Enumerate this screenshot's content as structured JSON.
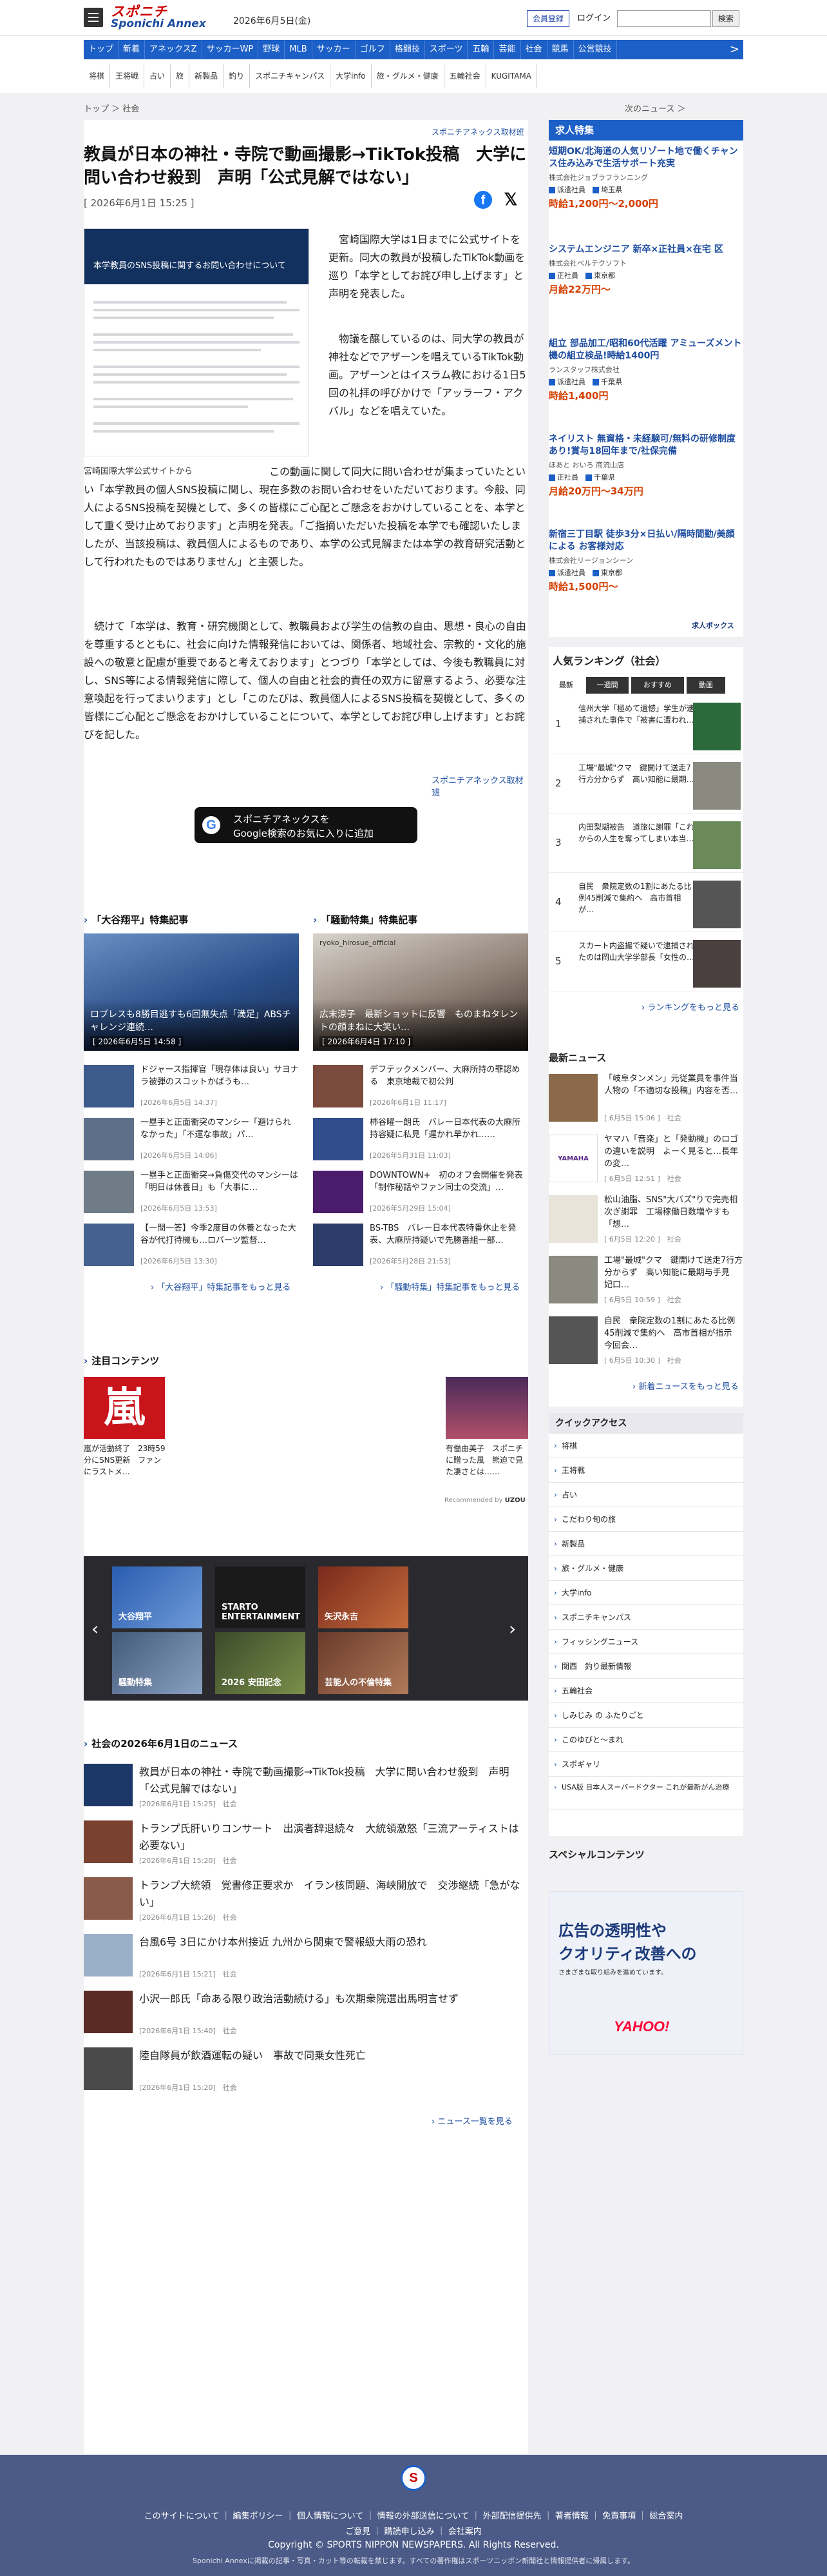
{
  "header": {
    "logo_line1": "スポニチ",
    "logo_line2": "Sponichi Annex",
    "date": "2026年6月5日(金)",
    "member_label": "会員登録",
    "login_label": "ログイン",
    "search_placeholder": "",
    "search_button": "検索"
  },
  "nav": [
    "トップ",
    "新着",
    "アネックスZ",
    "サッカーWP",
    "野球",
    "MLB",
    "サッカー",
    "ゴルフ",
    "格闘技",
    "スポーツ",
    "五輪",
    "芸能",
    "社会",
    "競馬",
    "公営競技"
  ],
  "subnav": [
    "将棋",
    "王将戦",
    "占い",
    "旅",
    "新製品",
    "釣り",
    "スポニチキャンパス",
    "大学info",
    "旅・グルメ・健康",
    "五輪社会",
    "KUGITAMA"
  ],
  "breadcrumb": "トップ ＞ 社会",
  "next_label": "次のニュース ＞",
  "article": {
    "source": "スポニチアネックス取材班",
    "title": "教員が日本の神社・寺院で動画撮影→TikTok投稿　大学に問い合わせ殺到　声明「公式見解ではない」",
    "date": "[ 2026年6月1日 15:25 ]",
    "photo_heading": "本学教員のSNS投稿に関するお問い合わせについて",
    "photo_caption": "宮崎国際大学公式サイトから",
    "p1": "宮崎国際大学は1日までに公式サイトを更新。同大の教員が投稿したTikTok動画を巡り「本学としてお詫び申し上げます」と声明を発表した。",
    "p2": "物議を醸しているのは、同大学の教員が神社などでアザーンを唱えているTikTok動画。アザーンとはイスラム教における1日5回の礼拝の呼びかけで「アッラーフ・アクバル」などを唱えていた。",
    "p3": "この動画に関して同大に問い合わせが集まっていたといい「本学教員の個人SNS投稿に関し、現在多数のお問い合わせをいただいております。今般、同人によるSNS投稿を契機として、多くの皆様にご心配とご懸念をおかけしていることを、本学として重く受け止めております」と声明を発表。「ご指摘いただいた投稿を本学でも確認いたしましたが、当該投稿は、教員個人によるものであり、本学の公式見解または本学の教育研究活動として行われたものではありません」と主張した。",
    "p4": "続けて「本学は、教育・研究機関として、教職員および学生の信教の自由、思想・良心の自由を尊重するとともに、社会に向けた情報発信においては、関係者、地域社会、宗教的・文化的施設への敬意と配慮が重要であると考えております」とつづり「本学としては、今後も教職員に対し、SNS等による情報発信に際して、個人の自由と社会的責任の双方に留意するよう、必要な注意喚起を行ってまいります」とし「このたびは、教員個人によるSNS投稿を契機として、多くの皆様にご心配とご懸念をおかけしていることについて、本学としてお詫び申し上げます」とお詫びを記した。",
    "source_bottom": "スポニチアネックス取材班",
    "google_line1": "スポニチアネックスを",
    "google_line2": "Google検索のお気に入りに追加"
  },
  "features": {
    "left": {
      "title": "「大谷翔平」特集記事",
      "hero_title": "ロブレスも8勝目逃すも6回無失点「満足」ABSチャレンジ連続…",
      "hero_date": "[ 2026年6月5日 14:58 ]",
      "items": [
        {
          "title": "ドジャース指揮官「現存体は良い」サヨナラ被弾のスコットかばうも…",
          "date": "[2026年6月5日 14:37]"
        },
        {
          "title": "一塁手と正面衝突のマンシー「避けられなかった」「不運な事故」パ…",
          "date": "[2026年6月5日 14:06]"
        },
        {
          "title": "一塁手と正面衝突→負傷交代のマンシーは「明日は休養日」も「大事に…",
          "date": "[2026年6月5日 13:53]"
        },
        {
          "title": "【一問一答】今季2度目の休養となった大谷が代打待機も…ロバーツ監督…",
          "date": "[2026年6月5日 13:30]"
        }
      ],
      "more": "「大谷翔平」特集記事をもっと見る"
    },
    "right": {
      "title": "「騒動特集」特集記事",
      "hero_title": "広末涼子　最新ショットに反響　ものまねタレントの顔まねに大笑い…",
      "hero_date": "[ 2026年6月4日 17:10 ]",
      "hero_account": "ryoko_hirosue_official",
      "items": [
        {
          "title": "デフテックメンバー、大麻所持の罪認める　東京地裁で初公判",
          "date": "[2026年6月1日 11:17]"
        },
        {
          "title": "柿谷曜一朗氏　バレー日本代表の大麻所持容疑に私見「遅かれ早かれ……",
          "date": "[2026年5月31日 11:03]"
        },
        {
          "title": "DOWNTOWN+　初のオフ会開催を発表「制作秘話やファン同士の交流」…",
          "date": "[2026年5月29日 15:04]"
        },
        {
          "title": "BS-TBS　バレー日本代表特番休止を発表、大麻所持疑いで先勝番組一部…",
          "date": "[2026年5月28日 21:53]"
        }
      ],
      "more": "「騒動特集」特集記事をもっと見る"
    }
  },
  "attention": {
    "title": "注目コンテンツ",
    "left_title": "嵐が活動終了　23時59分にSNS更新　ファンにラストメ…",
    "right_title": "有働由美子　スポニチに贈った風　熊迫で見た凄さとは……",
    "recommend": "Recommended by",
    "uzou": "UZOU"
  },
  "slider": [
    {
      "label": "大谷翔平"
    },
    {
      "label": "STARTO ENTERTAINMENT"
    },
    {
      "label": "矢沢永吉"
    },
    {
      "label": "騒動特集"
    },
    {
      "label": "2026 安田記念"
    },
    {
      "label": "芸能人の不倫特集"
    }
  ],
  "daily": {
    "title": "社会の2026年6月1日のニュース",
    "items": [
      {
        "title": "教員が日本の神社・寺院で動画撮影→TikTok投稿　大学に問い合わせ殺到　声明「公式見解ではない」",
        "date": "[2026年6月1日 15:25]　社会"
      },
      {
        "title": "トランプ氏肝いりコンサート　出演者辞退続々　大統領激怒「三流アーティストは必要ない」",
        "date": "[2026年6月1日 15:20]　社会"
      },
      {
        "title": "トランプ大統領　覚書修正要求か　イラン核問題、海峡開放で　交渉継続「急がない」",
        "date": "[2026年6月1日 15:26]　社会"
      },
      {
        "title": "台風6号 3日にかけ本州接近 九州から関東で警報級大雨の恐れ",
        "date": "[2026年6月1日 15:21]　社会"
      },
      {
        "title": "小沢一郎氏「命ある限り政治活動続ける」も次期衆院選出馬明言せず",
        "date": "[2026年6月1日 15:40]　社会"
      },
      {
        "title": "陸自隊員が飲酒運転の疑い　事故で同乗女性死亡",
        "date": "[2026年6月1日 15:20]　社会"
      }
    ],
    "more": "ニュース一覧を見る"
  },
  "jobs": {
    "title": "求人特集",
    "items": [
      {
        "title": "短期OK/北海道の人気リゾート地で働くチャンス住み込みで生活サポート充実",
        "company": "株式会社ジョブラフランニング",
        "type": "派遣社員",
        "place": "埼玉県",
        "salary": "時給1,200円～2,000円"
      },
      {
        "title": "システムエンジニア 新卒×正社員×在宅 区",
        "company": "株式会社ベルテクソフト",
        "type": "正社員",
        "place": "東京都",
        "salary": "月給22万円～"
      },
      {
        "title": "組立 部品加工/昭和60代活躍 アミューズメント機の組立検品!時給1400円",
        "company": "ランスタッフ株式会社",
        "type": "派遣社員",
        "place": "千葉県",
        "salary": "時給1,400円"
      },
      {
        "title": "ネイリスト 無資格・未経験可/無料の研修制度あり!賞与18回年まで/社保完備",
        "company": "ほあと おいろ 商流山店",
        "type": "正社員",
        "place": "千葉県",
        "salary": "月給20万円～34万円"
      },
      {
        "title": "新宿三丁目駅 徒歩3分×日払い/隔時間勤/美顔による お客様対応",
        "company": "株式会社リージョンシーン",
        "type": "派遣社員",
        "place": "東京都",
        "salary": "時給1,500円～"
      }
    ],
    "footer": "求人ボックス"
  },
  "ranking": {
    "title": "人気ランキング（社会）",
    "tabs": [
      "最新",
      "一週間",
      "おすすめ",
      "動画"
    ],
    "items": [
      {
        "n": "1",
        "title": "信州大学「極めて遺憾」学生が逮捕された事件で「被害に遭われ…"
      },
      {
        "n": "2",
        "title": "工場\"最城\"クマ　鍵開けて送走7行方分からず　高い知能に最期…"
      },
      {
        "n": "3",
        "title": "内田梨瑚被告　道旅に謝罪「これからの人生を奪ってしまい本当…"
      },
      {
        "n": "4",
        "title": "自民　衆院定数の1割にあたる比例45削減で集約へ　高市首相が…"
      },
      {
        "n": "5",
        "title": "スカート内盗撮で疑いで逮捕されたのは岡山大学学部長「女性の…"
      }
    ],
    "more": "ランキングをもっと見る"
  },
  "latest": {
    "title": "最新ニュース",
    "items": [
      {
        "title": "「岐阜タンメン」元従業員を事件当人物の「不適切な投稿」内容を否…",
        "date": "[ 6月5日 15:06 ]　社会"
      },
      {
        "title": "ヤマハ「音楽」と「発動機」のロゴの違いを説明　よーく見ると…長年の変…",
        "date": "[ 6月5日 12:51 ]　社会"
      },
      {
        "title": "松山油脂、SNS\"大バズ\"りで完売相次ぎ謝罪　工場稼働日数増やすも「想…",
        "date": "[ 6月5日 12:20 ]　社会"
      },
      {
        "title": "工場\"最城\"クマ　鍵開けて送走7行方分からず　高い知能に最期与手見　妃口…",
        "date": "[ 6月5日 10:59 ]　社会"
      },
      {
        "title": "自民　衆院定数の1割にあたる比例45削減で集約へ　高市首相が指示　今回会…",
        "date": "[ 6月5日 10:30 ]　社会"
      }
    ],
    "more": "新着ニュースをもっと見る"
  },
  "quick": {
    "title": "クイックアクセス",
    "items": [
      "将棋",
      "王将戦",
      "占い",
      "こだわり旬の旅",
      "新製品",
      "旅・グルメ・健康",
      "大学info",
      "スポニチキャンパス",
      "フィッシングニュース",
      "関西　釣り最新情報",
      "五輪社会",
      "しみじみ の ふたりごと",
      "このゆびと～まれ",
      "スポギャリ",
      "USA版 日本人スーパードクター これが最新がん治療"
    ]
  },
  "special": {
    "title": "スペシャルコンテンツ",
    "ad_line1": "広告の透明性や",
    "ad_line2": "クオリティ改善への",
    "ad_line3": "さまざまな取り組みを進めています。",
    "yahoo": "YAHOO!"
  },
  "footer": {
    "links1": "このサイトについて ｜ 編集ポリシー ｜ 個人情報について ｜ 情報の外部送信について ｜ 外部配信提供先 ｜ 著者情報 ｜ 免責事項 ｜ 総合案内",
    "links2": "ご意見 ｜ 購読申し込み ｜ 会社案内",
    "copy": "Copyright © SPORTS NIPPON NEWSPAPERS. All Rights Reserved.",
    "note": "Sponichi Annexに掲載の記事・写真・カット等の転載を禁じます。すべての著作権はスポーツニッポン新聞社と情報提供者に帰属します。",
    "logo": "S"
  }
}
